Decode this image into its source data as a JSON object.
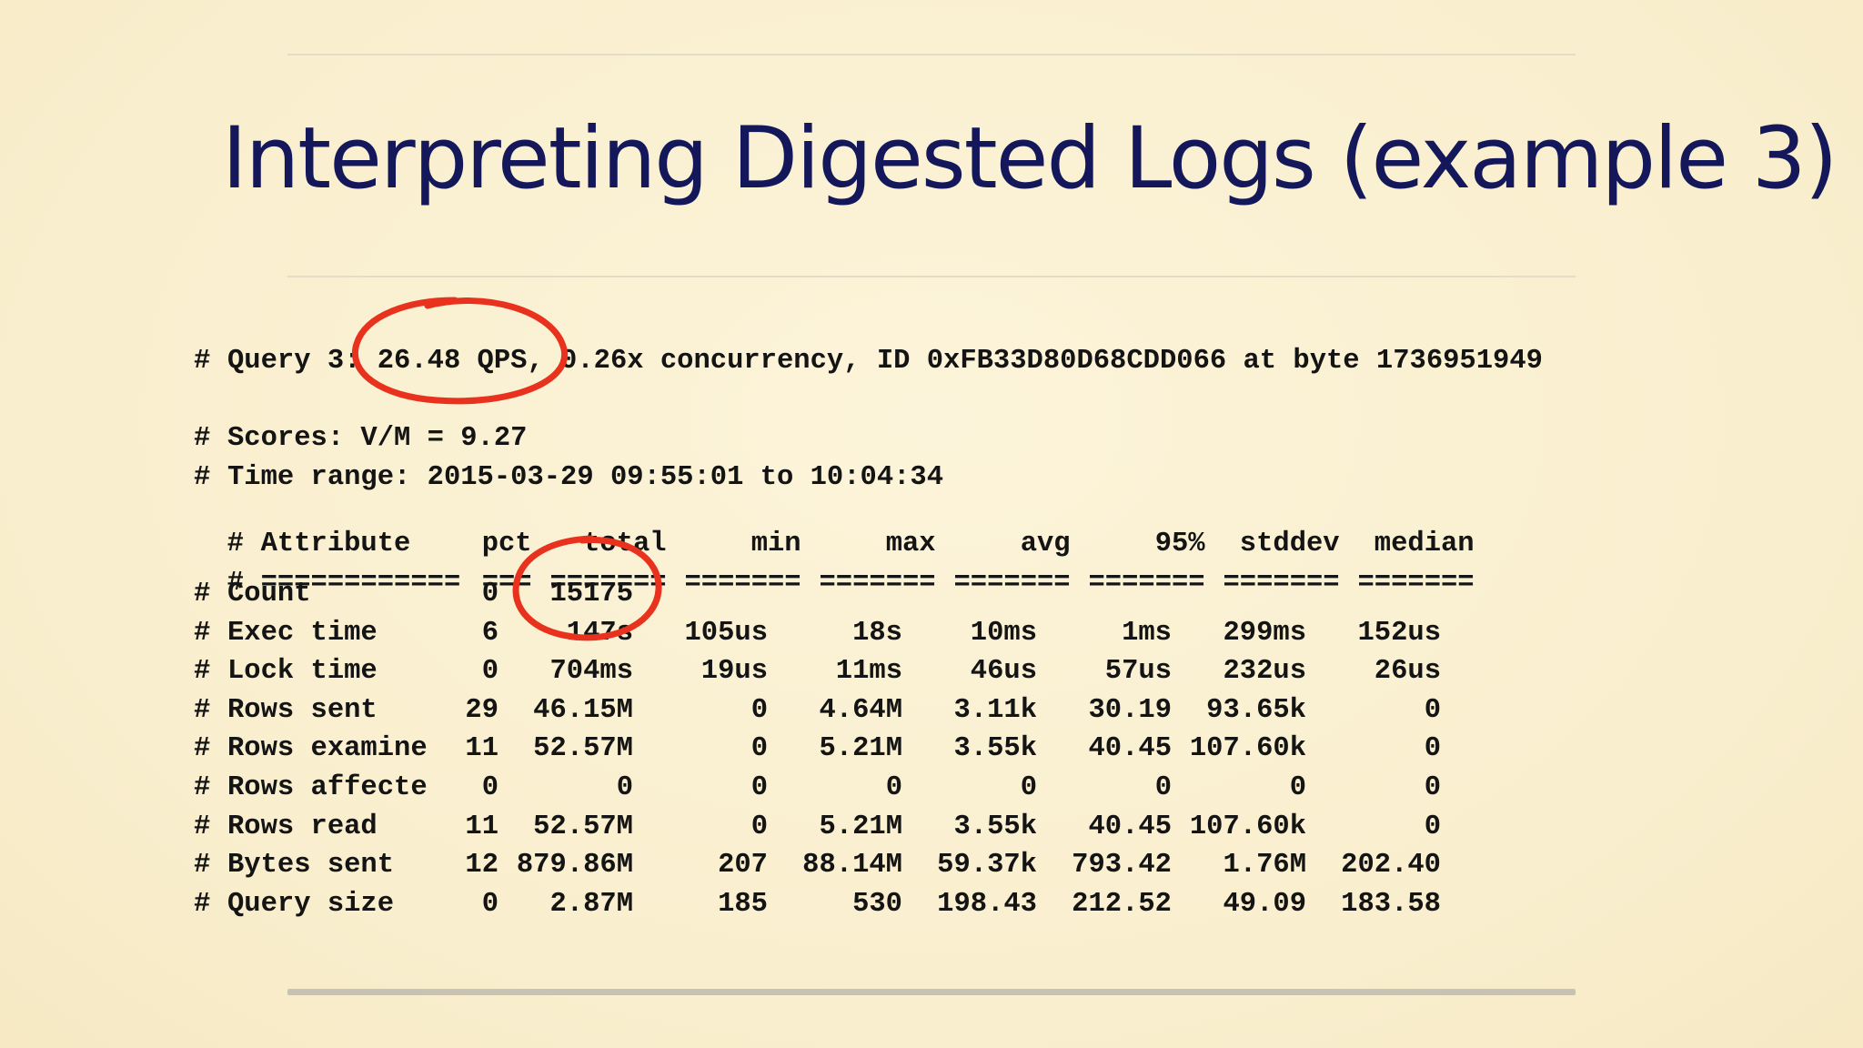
{
  "slide": {
    "title": "Interpreting Digested Logs (example 3)",
    "query_line": "Query 3: 26.48 QPS, 0.26x concurrency, ID 0xFB33D80D68CDD066 at byte 1736951949",
    "scores_line": "Scores: V/M = 9.27",
    "time_range_line": "Time range: 2015-03-29 09:55:01 to 10:04:34",
    "hash": "#"
  },
  "table": {
    "headers": [
      "Attribute",
      "pct",
      "total",
      "min",
      "max",
      "avg",
      "95%",
      "stddev",
      "median"
    ],
    "separators": [
      "============",
      "===",
      "=======",
      "=======",
      "=======",
      "=======",
      "=======",
      "=======",
      "======="
    ],
    "rows": [
      [
        "Count",
        "0",
        "15175",
        "",
        "",
        "",
        "",
        "",
        ""
      ],
      [
        "Exec time",
        "6",
        "147s",
        "105us",
        "18s",
        "10ms",
        "1ms",
        "299ms",
        "152us"
      ],
      [
        "Lock time",
        "0",
        "704ms",
        "19us",
        "11ms",
        "46us",
        "57us",
        "232us",
        "26us"
      ],
      [
        "Rows sent",
        "29",
        "46.15M",
        "0",
        "4.64M",
        "3.11k",
        "30.19",
        "93.65k",
        "0"
      ],
      [
        "Rows examine",
        "11",
        "52.57M",
        "0",
        "5.21M",
        "3.55k",
        "40.45",
        "107.60k",
        "0"
      ],
      [
        "Rows affecte",
        "0",
        "0",
        "0",
        "0",
        "0",
        "0",
        "0",
        "0"
      ],
      [
        "Rows read",
        "11",
        "52.57M",
        "0",
        "5.21M",
        "3.55k",
        "40.45",
        "107.60k",
        "0"
      ],
      [
        "Bytes sent",
        "12",
        "879.86M",
        "207",
        "88.14M",
        "59.37k",
        "793.42",
        "1.76M",
        "202.40"
      ],
      [
        "Query size",
        "0",
        "2.87M",
        "185",
        "530",
        "198.43",
        "212.52",
        "49.09",
        "183.58"
      ]
    ]
  },
  "colors": {
    "title": "#14185a",
    "text": "#141414",
    "annotation": "#e8321e",
    "background": "#faf0d2"
  }
}
